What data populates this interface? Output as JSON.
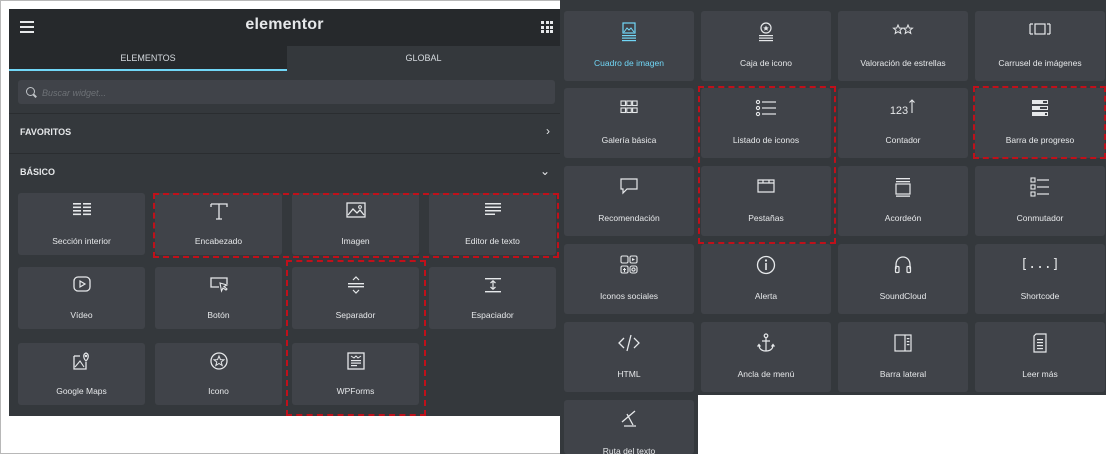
{
  "header": {
    "logo": "elementor"
  },
  "tabs": [
    {
      "label": "ELEMENTOS"
    },
    {
      "label": "GLOBAL"
    }
  ],
  "search": {
    "placeholder": "Buscar widget..."
  },
  "sections": [
    {
      "label": "FAVORITOS",
      "chevron": "›"
    },
    {
      "label": "BÁSICO",
      "chevron": "⌄"
    }
  ],
  "left_widgets": [
    {
      "label": "Sección interior",
      "icon": "columns-icon"
    },
    {
      "label": "Encabezado",
      "icon": "heading-icon"
    },
    {
      "label": "Imagen",
      "icon": "image-icon"
    },
    {
      "label": "Editor de texto",
      "icon": "text-editor-icon"
    },
    {
      "label": "Vídeo",
      "icon": "video-icon"
    },
    {
      "label": "Botón",
      "icon": "button-icon"
    },
    {
      "label": "Separador",
      "icon": "divider-icon"
    },
    {
      "label": "Espaciador",
      "icon": "spacer-icon"
    },
    {
      "label": "Google Maps",
      "icon": "map-icon"
    },
    {
      "label": "Icono",
      "icon": "star-circle-icon"
    },
    {
      "label": "WPForms",
      "icon": "wpforms-icon"
    }
  ],
  "right_widgets": [
    {
      "label": "Cuadro de imagen",
      "icon": "image-box-icon",
      "active": true
    },
    {
      "label": "Caja de icono",
      "icon": "icon-box-icon"
    },
    {
      "label": "Valoración de estrellas",
      "icon": "star-rating-icon"
    },
    {
      "label": "Carrusel de imágenes",
      "icon": "carousel-icon"
    },
    {
      "label": "Galería básica",
      "icon": "gallery-icon"
    },
    {
      "label": "Listado de iconos",
      "icon": "icon-list-icon"
    },
    {
      "label": "Contador",
      "icon": "counter-icon"
    },
    {
      "label": "Barra de progreso",
      "icon": "progress-bar-icon"
    },
    {
      "label": "Recomendación",
      "icon": "testimonial-icon"
    },
    {
      "label": "Pestañas",
      "icon": "tabs-icon"
    },
    {
      "label": "Acordeón",
      "icon": "accordion-icon"
    },
    {
      "label": "Conmutador",
      "icon": "toggle-icon"
    },
    {
      "label": "Iconos sociales",
      "icon": "social-icons-icon"
    },
    {
      "label": "Alerta",
      "icon": "alert-icon"
    },
    {
      "label": "SoundCloud",
      "icon": "soundcloud-icon"
    },
    {
      "label": "Shortcode",
      "icon": "shortcode-icon",
      "glyph": "[...]"
    },
    {
      "label": "HTML",
      "icon": "html-icon"
    },
    {
      "label": "Ancla de menú",
      "icon": "anchor-icon"
    },
    {
      "label": "Barra lateral",
      "icon": "sidebar-icon"
    },
    {
      "label": "Leer más",
      "icon": "read-more-icon"
    },
    {
      "label": "Ruta del texto",
      "icon": "text-path-icon"
    }
  ],
  "counter_glyph": "123",
  "colors": {
    "panel": "#34383c",
    "header": "#26292c",
    "widget": "#404349",
    "accent": "#71d7f7",
    "highlight": "#c0101a"
  }
}
